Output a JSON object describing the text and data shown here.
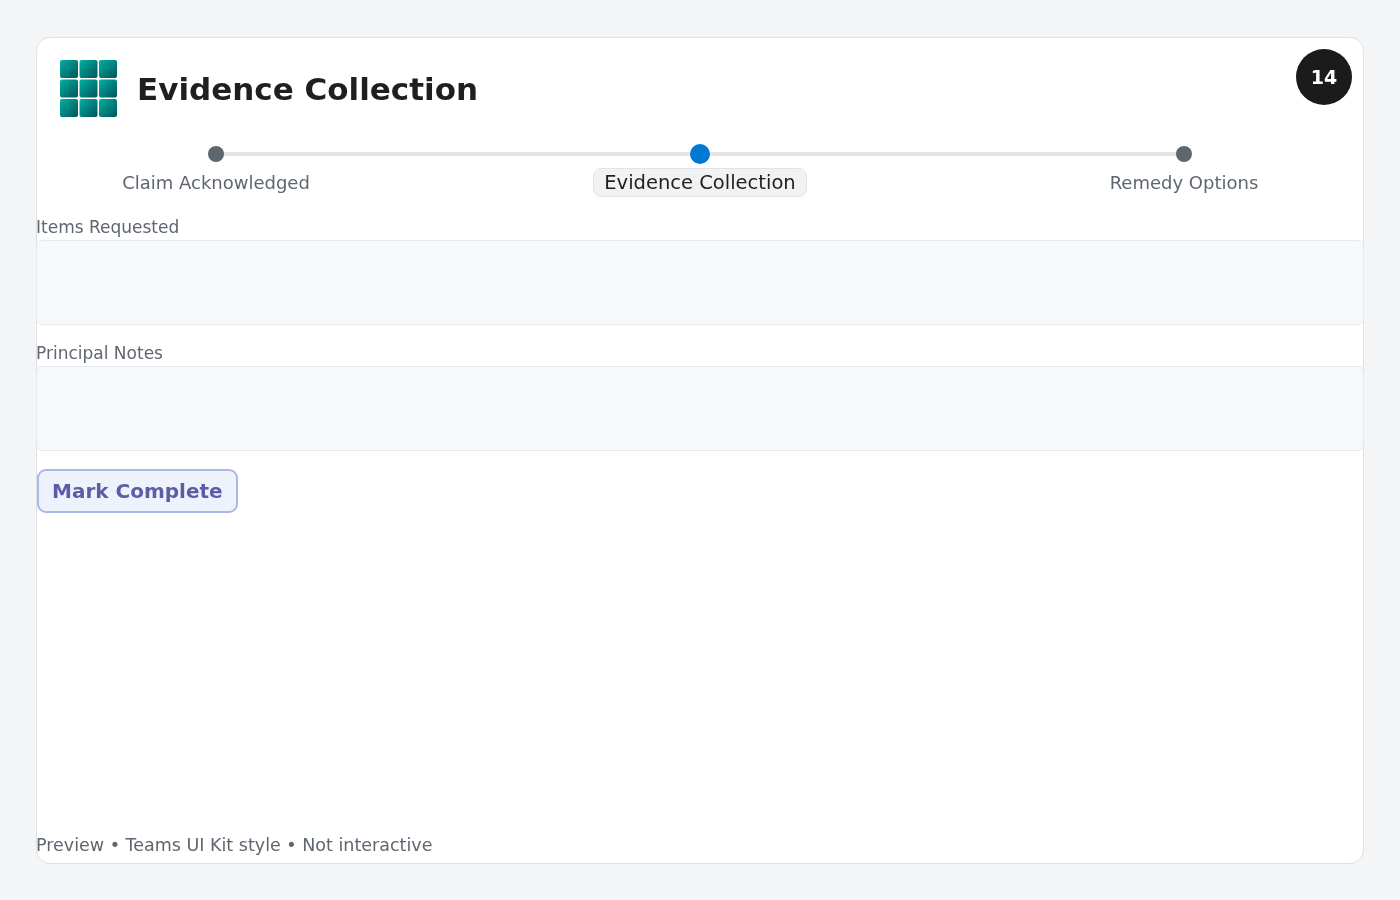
{
  "header": {
    "title": "Evidence Collection",
    "badge": "14"
  },
  "steps": [
    {
      "label": "Claim Acknowledged",
      "selected": false
    },
    {
      "label": "Evidence Collection",
      "selected": true
    },
    {
      "label": "Remedy Options",
      "selected": false
    }
  ],
  "fields": [
    {
      "label": "Items Requested"
    },
    {
      "label": "Principal Notes"
    }
  ],
  "button": {
    "label": "Mark Complete"
  },
  "footer": "Preview • Teams UI Kit style • Not interactive"
}
